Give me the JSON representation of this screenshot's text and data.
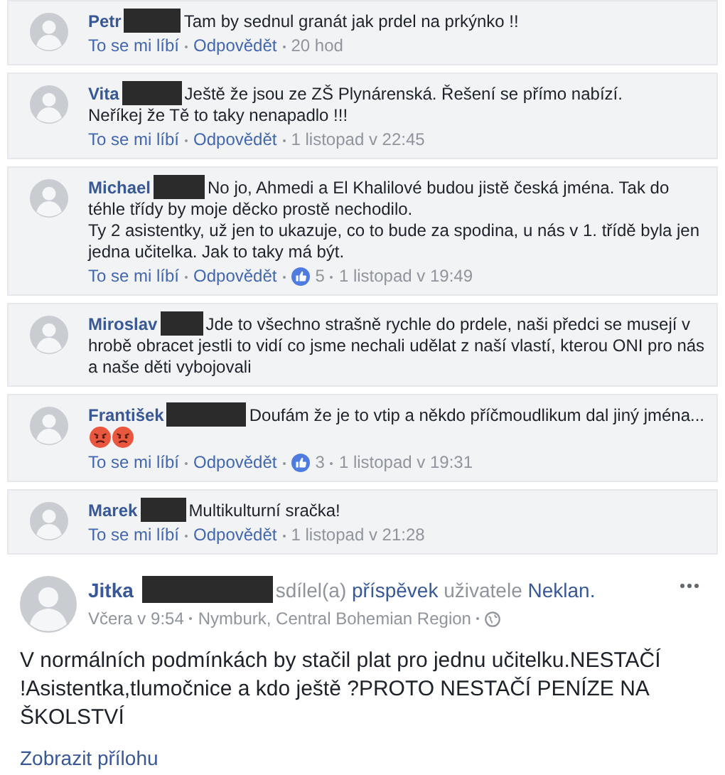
{
  "comments": [
    {
      "author": "Petr",
      "redacted": true,
      "text": "Tam by sednul granát jak prdel na prkýnko !!",
      "actions": [
        "To se mi líbí",
        "Odpovědět"
      ],
      "time": "20 hod"
    },
    {
      "author": "Vita",
      "redacted": true,
      "text": "Ještě že jsou ze ZŠ Plynárenská. Řešení se přímo nabízí.\nNeříkej že Tě to taky nenapadlo !!!",
      "actions": [
        "To se mi líbí",
        "Odpovědět"
      ],
      "time": "1 listopad v 22:45"
    },
    {
      "author": "Michael",
      "redacted": true,
      "text": "No jo, Ahmedi a El Khalilové budou jistě česká jména. Tak do téhle třídy by moje děcko prostě nechodilo.\nTy 2 asistentky, už jen to ukazuje, co to bude za spodina, u nás v 1. třídě byla jen jedna učitelka. Jak to taky má být.",
      "actions": [
        "To se mi líbí",
        "Odpovědět"
      ],
      "likes": "5",
      "time": "1 listopad v 19:49"
    },
    {
      "author": "Miroslav",
      "redacted": true,
      "text": "Jde to všechno strašně rychle do prdele, naši předci se musejí v hrobě obracet jestli to vidí co jsme nechali udělat z naší vlastí, kterou ONI pro nás a naše děti vybojovali"
    },
    {
      "author": "František",
      "redacted": true,
      "text": "Doufám že je to vtip a někdo příčmoudlikum dal jiný jména...",
      "emoji": [
        {
          "kind": "angry"
        },
        {
          "kind": "angry"
        }
      ],
      "actions": [
        "To se mi líbí",
        "Odpovědět"
      ],
      "likes": "3",
      "time": "1 listopad v 19:31"
    },
    {
      "author": "Marek",
      "redacted": true,
      "text": "Multikulturní sračka!",
      "actions": [
        "To se mi líbí",
        "Odpovědět"
      ],
      "time": "1 listopad v 21:28"
    }
  ],
  "post": {
    "author": "Jitka",
    "redacted": true,
    "shared": [
      {
        "kind": "plain",
        "text": "sdílel(a)"
      },
      {
        "kind": "link",
        "text": "příspěvek"
      },
      {
        "kind": "plain",
        "text": "uživatele"
      },
      {
        "kind": "link",
        "text": "Neklan."
      }
    ],
    "time": "Včera v 9:54",
    "location": "Nymburk, Central Bohemian Region",
    "public": true,
    "text": "V normálních podmínkách by stačil plat pro jednu učitelku.NESTAČÍ !Asistentka,tlumočnice a kdo ještě ?PROTO NESTAČÍ PENÍZE NA ŠKOLSTVÍ",
    "attachment_link": "Zobrazit přílohu"
  }
}
